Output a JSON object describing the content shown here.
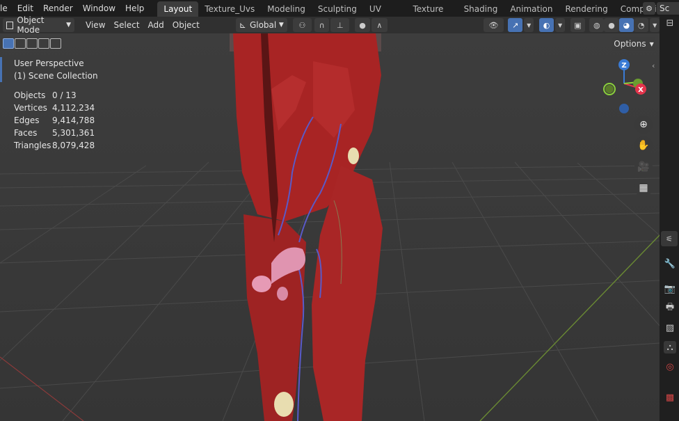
{
  "topmenu": [
    "le",
    "Edit",
    "Render",
    "Window",
    "Help"
  ],
  "workspace_tabs": [
    "Layout",
    "Texture_Uvs",
    "Modeling",
    "Sculpting",
    "UV Editing",
    "Texture Paint",
    "Shading",
    "Animation",
    "Rendering",
    "Compositing"
  ],
  "active_tab": "Layout",
  "scene_label": "Sc",
  "header": {
    "mode": "Object Mode",
    "menus": [
      "View",
      "Select",
      "Add",
      "Object"
    ],
    "orientation": "Global"
  },
  "viewport": {
    "view_name": "User Perspective",
    "collection": "(1) Scene Collection",
    "stats": [
      {
        "label": "Objects",
        "value": "0 / 13"
      },
      {
        "label": "Vertices",
        "value": "4,112,234"
      },
      {
        "label": "Edges",
        "value": "9,414,788"
      },
      {
        "label": "Faces",
        "value": "5,301,361"
      },
      {
        "label": "Triangles",
        "value": "8,079,428"
      }
    ],
    "options_label": "Options"
  },
  "gizmo": {
    "z": "Z",
    "x": "X"
  },
  "colors": {
    "accent": "#4772b3",
    "axis_x": "#e3344c",
    "axis_y": "#8bd13b",
    "axis_z": "#3a7bd5",
    "muscle": "#b32a2a"
  }
}
